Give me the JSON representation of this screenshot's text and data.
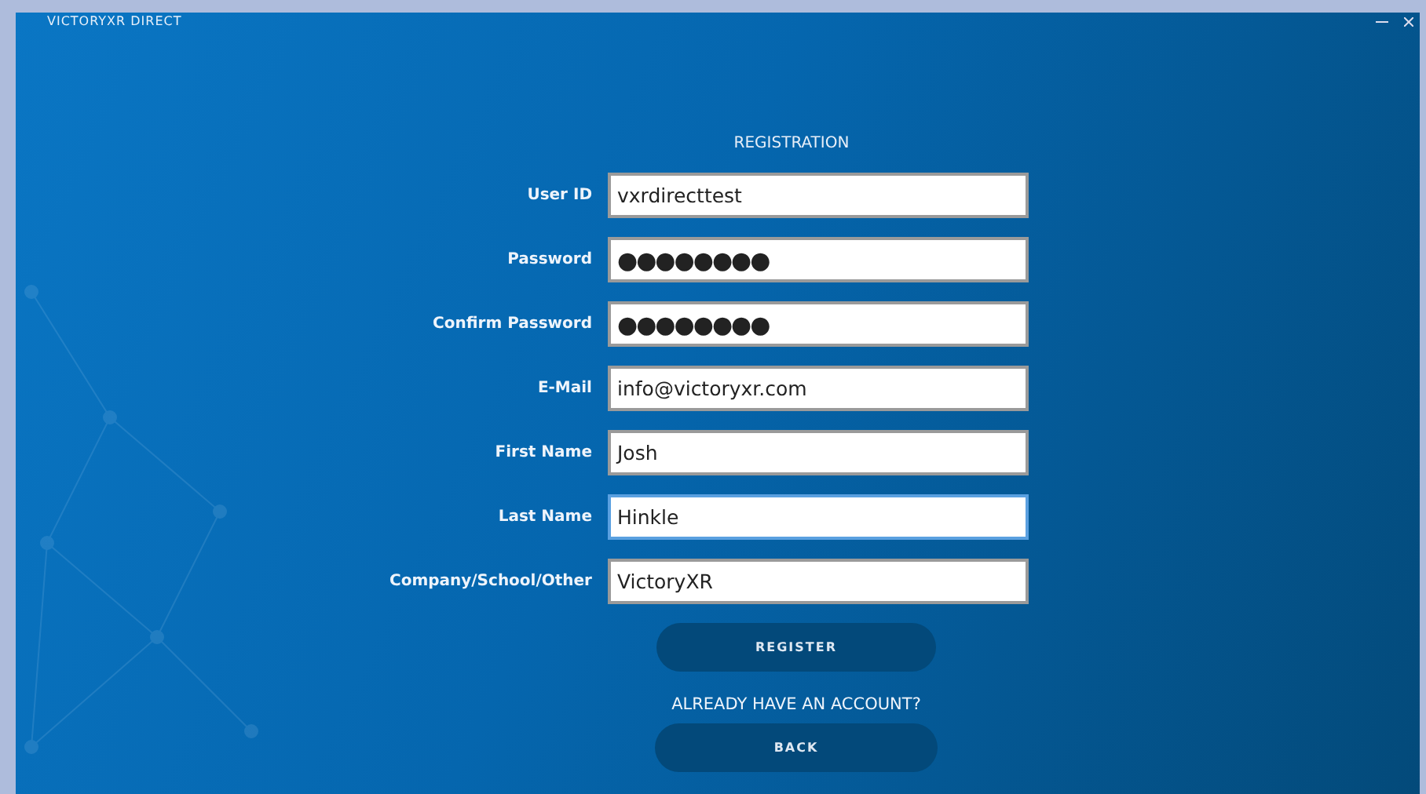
{
  "window": {
    "title": "VICTORYXR DIRECT"
  },
  "form": {
    "heading": "REGISTRATION",
    "fields": [
      {
        "label": "User ID",
        "value": "vxrdirecttest",
        "kind": "text",
        "focused": false
      },
      {
        "label": "Password",
        "value": "●●●●●●●●",
        "kind": "masked",
        "focused": false
      },
      {
        "label": "Confirm Password",
        "value": "●●●●●●●●",
        "kind": "masked",
        "focused": false
      },
      {
        "label": "E-Mail",
        "value": "info@victoryxr.com",
        "kind": "text",
        "focused": false
      },
      {
        "label": "First Name",
        "value": "Josh",
        "kind": "text",
        "focused": false
      },
      {
        "label": "Last Name",
        "value": "Hinkle",
        "kind": "text",
        "focused": true
      },
      {
        "label": "Company/School/Other",
        "value": "VictoryXR",
        "kind": "text",
        "focused": false
      }
    ],
    "register_button": "REGISTER",
    "account_prompt": "ALREADY HAVE AN ACCOUNT?",
    "back_button": "BACK"
  }
}
